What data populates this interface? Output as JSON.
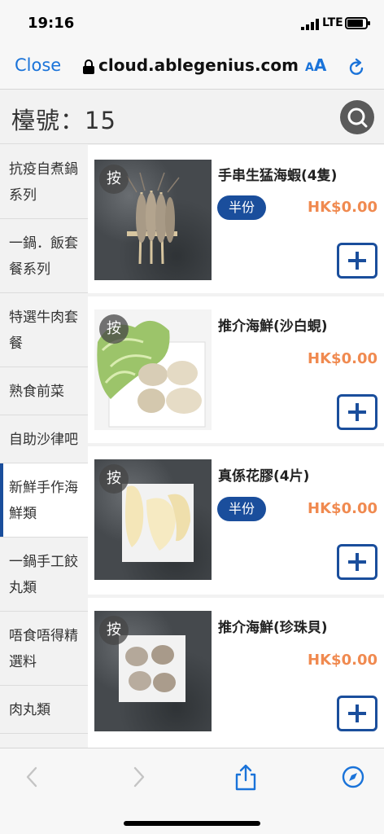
{
  "status_bar": {
    "time": "19:16",
    "network": "LTE",
    "battery_fraction": 0.85
  },
  "browser": {
    "close_label": "Close",
    "url": "cloud.ablegenius.com",
    "text_size_label_small": "A",
    "text_size_label_large": "A"
  },
  "header": {
    "table_label": "檯號：15"
  },
  "categories": [
    {
      "line1": "抗疫自煮鍋",
      "line2": "系列"
    },
    {
      "line1": "一鍋．飯套",
      "line2": "餐系列"
    },
    {
      "line1": "特選牛肉套",
      "line2": "餐"
    },
    {
      "line1": "熟食前菜",
      "line2": ""
    },
    {
      "line1": "自助沙律吧",
      "line2": ""
    },
    {
      "line1": "新鮮手作海",
      "line2": "鮮類"
    },
    {
      "line1": "一鍋手工餃",
      "line2": "丸類"
    },
    {
      "line1": "唔食唔得精",
      "line2": "選料"
    },
    {
      "line1": "肉丸類",
      "line2": ""
    }
  ],
  "active_category_index": 5,
  "items": [
    {
      "name": "手串生猛海蝦(4隻)",
      "badge": "按",
      "half_label": "半份",
      "price": "HK$0.00"
    },
    {
      "name": "推介海鮮(沙白蜆)",
      "badge": "按",
      "half_label": "",
      "price": "HK$0.00"
    },
    {
      "name": "真係花膠(4片)",
      "badge": "按",
      "half_label": "半份",
      "price": "HK$0.00"
    },
    {
      "name": "推介海鮮(珍珠貝)",
      "badge": "按",
      "half_label": "",
      "price": "HK$0.00"
    }
  ],
  "colors": {
    "accent": "#1a4e9c",
    "price": "#f08a50",
    "link": "#1a73d9"
  }
}
